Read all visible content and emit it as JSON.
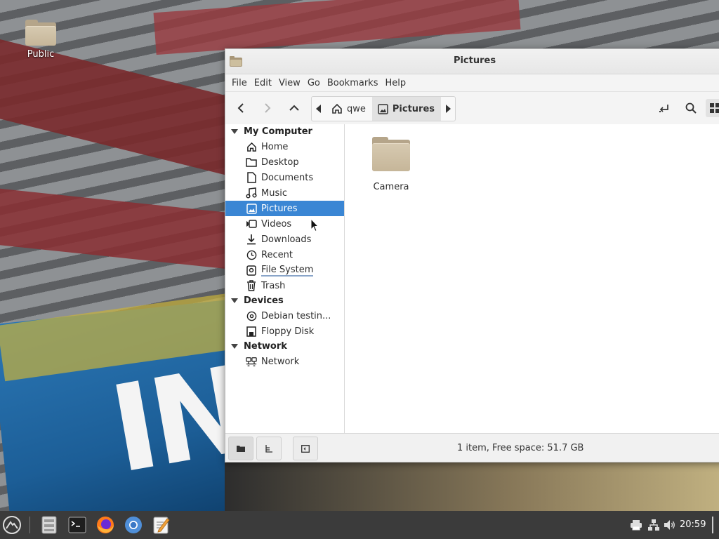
{
  "desktop": {
    "icons": [
      {
        "label": "Public",
        "icon": "folder-icon"
      }
    ]
  },
  "window": {
    "title": "Pictures",
    "menu": [
      "File",
      "Edit",
      "View",
      "Go",
      "Bookmarks",
      "Help"
    ],
    "toolbar": {
      "back_icon": "arrow-left-icon",
      "forward_icon": "arrow-right-icon",
      "up_icon": "arrow-up-icon",
      "toggle_location_icon": "location-toggle-icon",
      "search_icon": "search-icon",
      "view_icon": "icon-view-icon"
    },
    "pathbar": {
      "crumbs": [
        {
          "label": "qwe",
          "icon": "home-icon"
        },
        {
          "label": "Pictures",
          "icon": "image-icon",
          "active": true
        }
      ]
    },
    "sidebar": {
      "sections": [
        {
          "title": "My Computer",
          "items": [
            {
              "label": "Home",
              "icon": "home-icon"
            },
            {
              "label": "Desktop",
              "icon": "folder-icon"
            },
            {
              "label": "Documents",
              "icon": "document-icon"
            },
            {
              "label": "Music",
              "icon": "music-icon"
            },
            {
              "label": "Pictures",
              "icon": "image-icon",
              "selected": true
            },
            {
              "label": "Videos",
              "icon": "video-icon"
            },
            {
              "label": "Downloads",
              "icon": "download-icon"
            },
            {
              "label": "Recent",
              "icon": "clock-icon"
            },
            {
              "label": "File System",
              "icon": "drive-icon"
            },
            {
              "label": "Trash",
              "icon": "trash-icon"
            }
          ]
        },
        {
          "title": "Devices",
          "items": [
            {
              "label": "Debian testin...",
              "icon": "disc-icon"
            },
            {
              "label": "Floppy Disk",
              "icon": "floppy-icon"
            }
          ]
        },
        {
          "title": "Network",
          "items": [
            {
              "label": "Network",
              "icon": "network-icon"
            }
          ]
        }
      ]
    },
    "content": {
      "items": [
        {
          "label": "Camera",
          "icon": "folder-icon"
        }
      ]
    },
    "statusbar": {
      "text": "1 item, Free space: 51.7 GB"
    }
  },
  "taskbar": {
    "apps": [
      "menu-icon",
      "file-manager-icon",
      "terminal-icon",
      "firefox-icon",
      "chromium-icon",
      "text-editor-icon"
    ],
    "clock": "20:59"
  },
  "colors": {
    "selection": "#3a86d4",
    "taskbar": "#3b3b3b"
  }
}
